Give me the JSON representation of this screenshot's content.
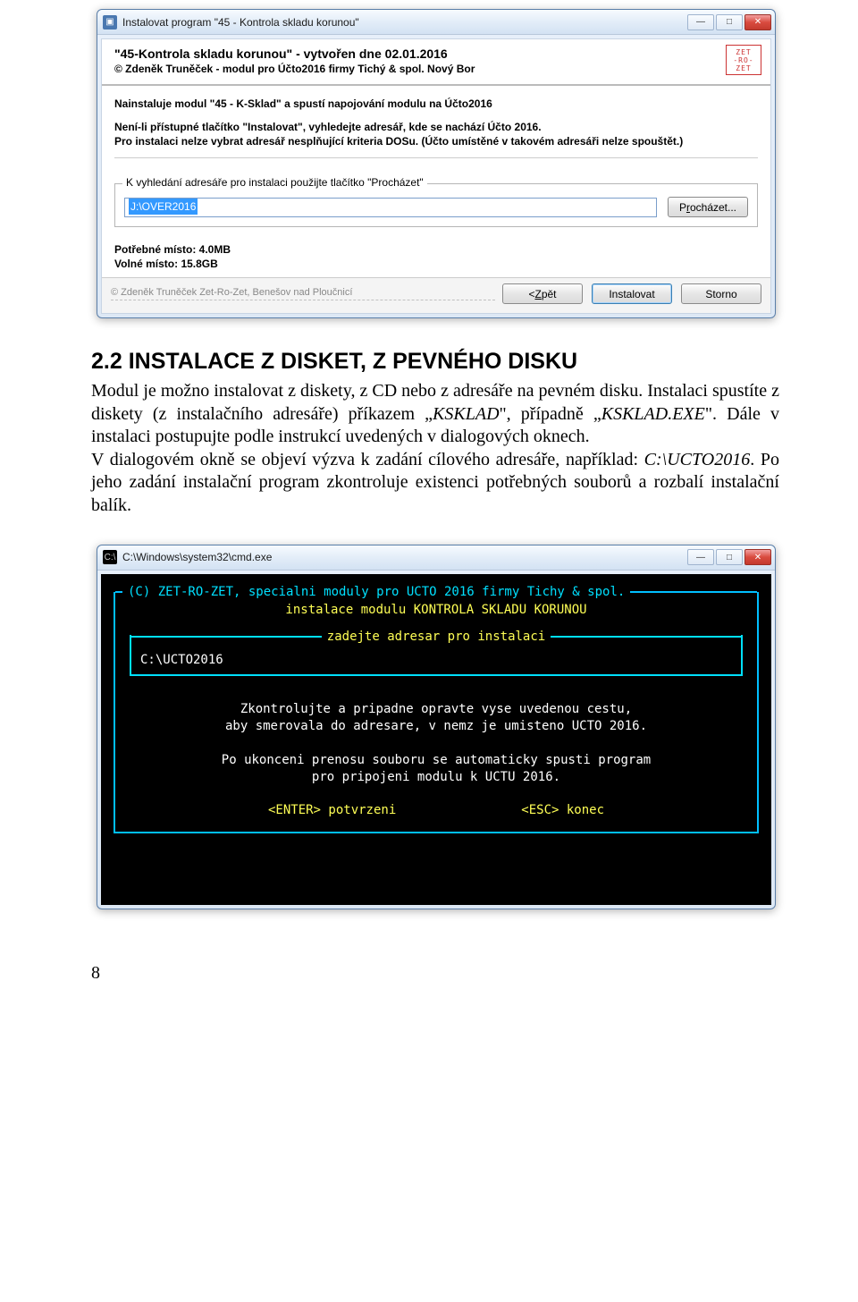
{
  "installer": {
    "window_title": "Instalovat program \"45 - Kontrola skladu korunou\"",
    "header_title": "\"45-Kontrola skladu korunou\" - vytvořen dne 02.01.2016",
    "header_sub": "© Zdeněk Truněček - modul pro Účto2016 firmy Tichý & spol. Nový Bor",
    "logo_lines": [
      "ZET",
      "-RO-",
      "ZET"
    ],
    "info_line1": "Nainstaluje modul \"45 - K-Sklad\" a spustí napojování modulu na Účto2016",
    "info_line2": "Není-li přístupné tlačítko \"Instalovat\", vyhledejte adresář, kde se nachází Účto  2016.",
    "info_line3": "Pro instalaci nelze vybrat adresář nesplňující kriteria DOSu. (Účto umístěné v takovém adresáři nelze spouštět.)",
    "group_label": "K vyhledání adresáře pro instalaci použijte tlačítko \"Procházet\"",
    "path_value": "J:\\OVER2016",
    "browse_label_pre": "P",
    "browse_label_u": "r",
    "browse_label_post": "ocházet...",
    "space_req_label": "Potřebné místo: 4.0MB",
    "space_free_label": "Volné místo: 15.8GB",
    "footer_copy": "© Zdeněk Truněček Zet-Ro-Zet, Benešov nad Ploučnicí",
    "back_label_pre": "< ",
    "back_label_u": "Z",
    "back_label_post": "pět",
    "install_label": "Instalovat",
    "cancel_label": "Storno"
  },
  "doc": {
    "heading": "2.2 INSTALACE Z DISKET, Z PEVNÉHO DISKU",
    "p1_a": "Modul je možno instalovat z diskety, z CD nebo z adresáře na pevném disku. Instalaci spustíte z diskety (z instalačního adresáře) příkazem „",
    "p1_i1": "KSKLAD",
    "p1_b": "\", případně „",
    "p1_i2": "KSKLAD.EXE",
    "p1_c": "\". Dále v instalaci postupujte podle instrukcí uvedených v dialogových oknech.",
    "p2_a": "V dialogovém okně se objeví výzva k zadání cílového adresáře, například: ",
    "p2_i1": "C:\\UCTO2016",
    "p2_b": ". Po jeho zadání instalační program zkontroluje existenci potřebných souborů a rozbalí instalační balík."
  },
  "cmd": {
    "window_title": "C:\\Windows\\system32\\cmd.exe",
    "header1": "(C) ZET-RO-ZET, specialni moduly pro UCTO 2016 firmy Tichy & spol.",
    "header2": "instalace modulu KONTROLA SKLADU KORUNOU",
    "inner_label": "zadejte adresar pro instalaci",
    "inner_path": "C:\\UCTO2016",
    "msg1": "Zkontrolujte a pripadne opravte vyse uvedenou cestu,",
    "msg2": "aby smerovala do adresare, v nemz je umisteno UCTO 2016.",
    "msg3": "Po ukonceni prenosu souboru se automaticky spusti program",
    "msg4": "pro pripojeni modulu k UCTU 2016.",
    "key_enter": "<ENTER> potvrzeni",
    "key_esc": "<ESC>  konec"
  },
  "page_number": "8"
}
